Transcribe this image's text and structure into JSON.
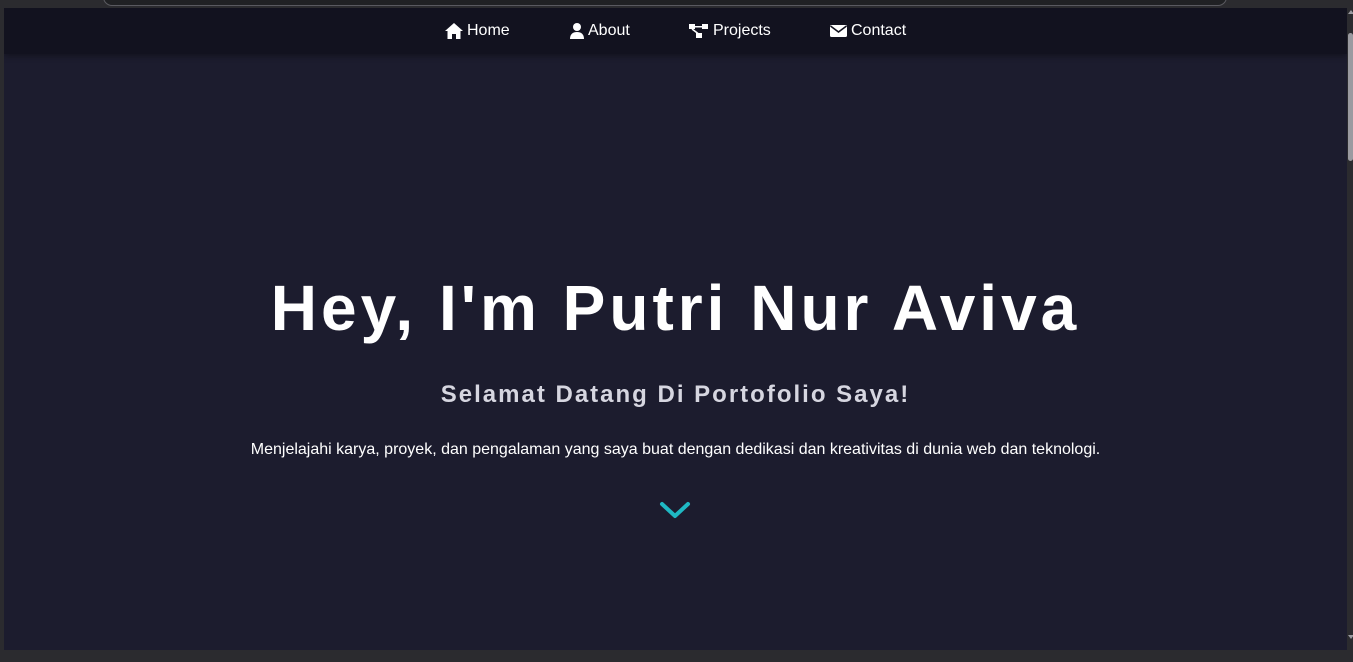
{
  "nav": {
    "items": [
      {
        "label": "Home",
        "icon": "home-icon"
      },
      {
        "label": "About",
        "icon": "user-icon"
      },
      {
        "label": "Projects",
        "icon": "project-diagram-icon"
      },
      {
        "label": "Contact",
        "icon": "envelope-icon"
      }
    ]
  },
  "hero": {
    "title": "Hey, I'm Putri Nur Aviva",
    "subtitle": "Selamat Datang Di Portofolio Saya!",
    "description": "Menjelajahi karya, proyek, dan pengalaman yang saya buat dengan dedikasi dan kreativitas di dunia web dan teknologi.",
    "scroll_icon": "chevron-down-icon"
  },
  "colors": {
    "background": "#1c1c2e",
    "navbar": "#12121f",
    "accent": "#1fb8c3",
    "text": "#ffffff"
  }
}
